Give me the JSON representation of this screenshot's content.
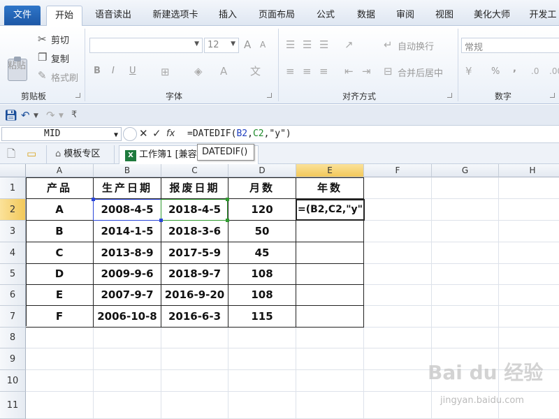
{
  "ribbon_tabs": [
    "文件",
    "开始",
    "语音读出",
    "新建选项卡",
    "插入",
    "页面布局",
    "公式",
    "数据",
    "审阅",
    "视图",
    "美化大师",
    "开发工"
  ],
  "clipboard": {
    "paste": "粘贴",
    "cut": "剪切",
    "copy": "复制",
    "format_painter": "格式刷",
    "label": "剪贴板"
  },
  "font": {
    "size": "12",
    "bold": "B",
    "italic": "I",
    "underline": "U",
    "label": "字体",
    "grow": "A",
    "shrink": "A"
  },
  "alignment": {
    "wrap": "自动换行",
    "merge": "合并后居中",
    "label": "对齐方式"
  },
  "number": {
    "format": "常规",
    "percent": "%",
    "comma": ",",
    "label": "数字"
  },
  "formula_bar": {
    "name_box": "MID",
    "fx": "fx",
    "formula_prefix": "=DATEDIF(",
    "ref1": "B2",
    "sep1": ",",
    "ref2": "C2",
    "formula_suffix": ",\"y\")"
  },
  "doc_tabs": {
    "template": "模板专区",
    "workbook": "工作簿1",
    "compat": "[兼容"
  },
  "tooltip": "DATEDIF()",
  "columns": [
    "A",
    "B",
    "C",
    "D",
    "E",
    "F",
    "G",
    "H"
  ],
  "rows": [
    "1",
    "2",
    "3",
    "4",
    "5",
    "6",
    "7",
    "8",
    "9",
    "10",
    "11"
  ],
  "table": {
    "headers": [
      "产品",
      "生产日期",
      "报废日期",
      "月数",
      "年数"
    ],
    "data": [
      [
        "A",
        "2008-4-5",
        "2018-4-5",
        "120",
        "=(B2,C2,\"y\")"
      ],
      [
        "B",
        "2014-1-5",
        "2018-3-6",
        "50",
        ""
      ],
      [
        "C",
        "2013-8-9",
        "2017-5-9",
        "45",
        ""
      ],
      [
        "D",
        "2009-9-6",
        "2018-9-7",
        "108",
        ""
      ],
      [
        "E",
        "2007-9-7",
        "2016-9-20",
        "108",
        ""
      ],
      [
        "F",
        "2006-10-8",
        "2016-6-3",
        "115",
        ""
      ]
    ]
  },
  "watermark": "Bai du 经验",
  "watermark_url": "jingyan.baidu.com"
}
